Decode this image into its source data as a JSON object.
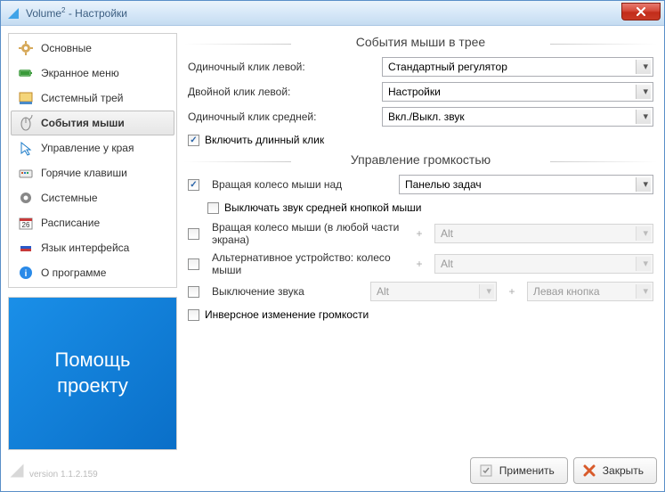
{
  "window": {
    "title_prefix": "Volume",
    "title_suffix": " - Настройки"
  },
  "sidebar": {
    "items": [
      {
        "label": "Основные"
      },
      {
        "label": "Экранное меню"
      },
      {
        "label": "Системный трей"
      },
      {
        "label": "События мыши"
      },
      {
        "label": "Управление у края"
      },
      {
        "label": "Горячие клавиши"
      },
      {
        "label": "Системные"
      },
      {
        "label": "Расписание"
      },
      {
        "label": "Язык интерфейса"
      },
      {
        "label": "О программе"
      }
    ],
    "help": "Помощь проекту"
  },
  "sections": {
    "tray": {
      "title": "События мыши в трее",
      "rows": {
        "single_left": {
          "label": "Одиночный клик левой:",
          "value": "Стандартный регулятор"
        },
        "double_left": {
          "label": "Двойной клик левой:",
          "value": "Настройки"
        },
        "single_middle": {
          "label": "Одиночный клик средней:",
          "value": "Вкл./Выкл. звук"
        }
      },
      "long_click": {
        "checked": true,
        "label": "Включить длинный клик"
      }
    },
    "volume": {
      "title": "Управление громкостью",
      "wheel_over": {
        "checked": true,
        "label": "Вращая колесо мыши над",
        "value": "Панелью задач"
      },
      "mute_middle": {
        "checked": false,
        "label": "Выключать звук средней кнопкой мыши"
      },
      "wheel_anywhere": {
        "checked": false,
        "label": "Вращая колесо мыши (в любой части экрана)",
        "mod": "Alt"
      },
      "alt_device": {
        "checked": false,
        "label": "Альтернативное устройство: колесо мыши",
        "mod": "Alt"
      },
      "mute_toggle": {
        "checked": false,
        "label": "Выключение звука",
        "mod1": "Alt",
        "mod2": "Левая кнопка"
      },
      "inverse": {
        "checked": false,
        "label": "Инверсное изменение громкости"
      }
    }
  },
  "footer": {
    "version_prefix": "version ",
    "version": "1.1.2.159",
    "apply": "Применить",
    "close": "Закрыть"
  }
}
